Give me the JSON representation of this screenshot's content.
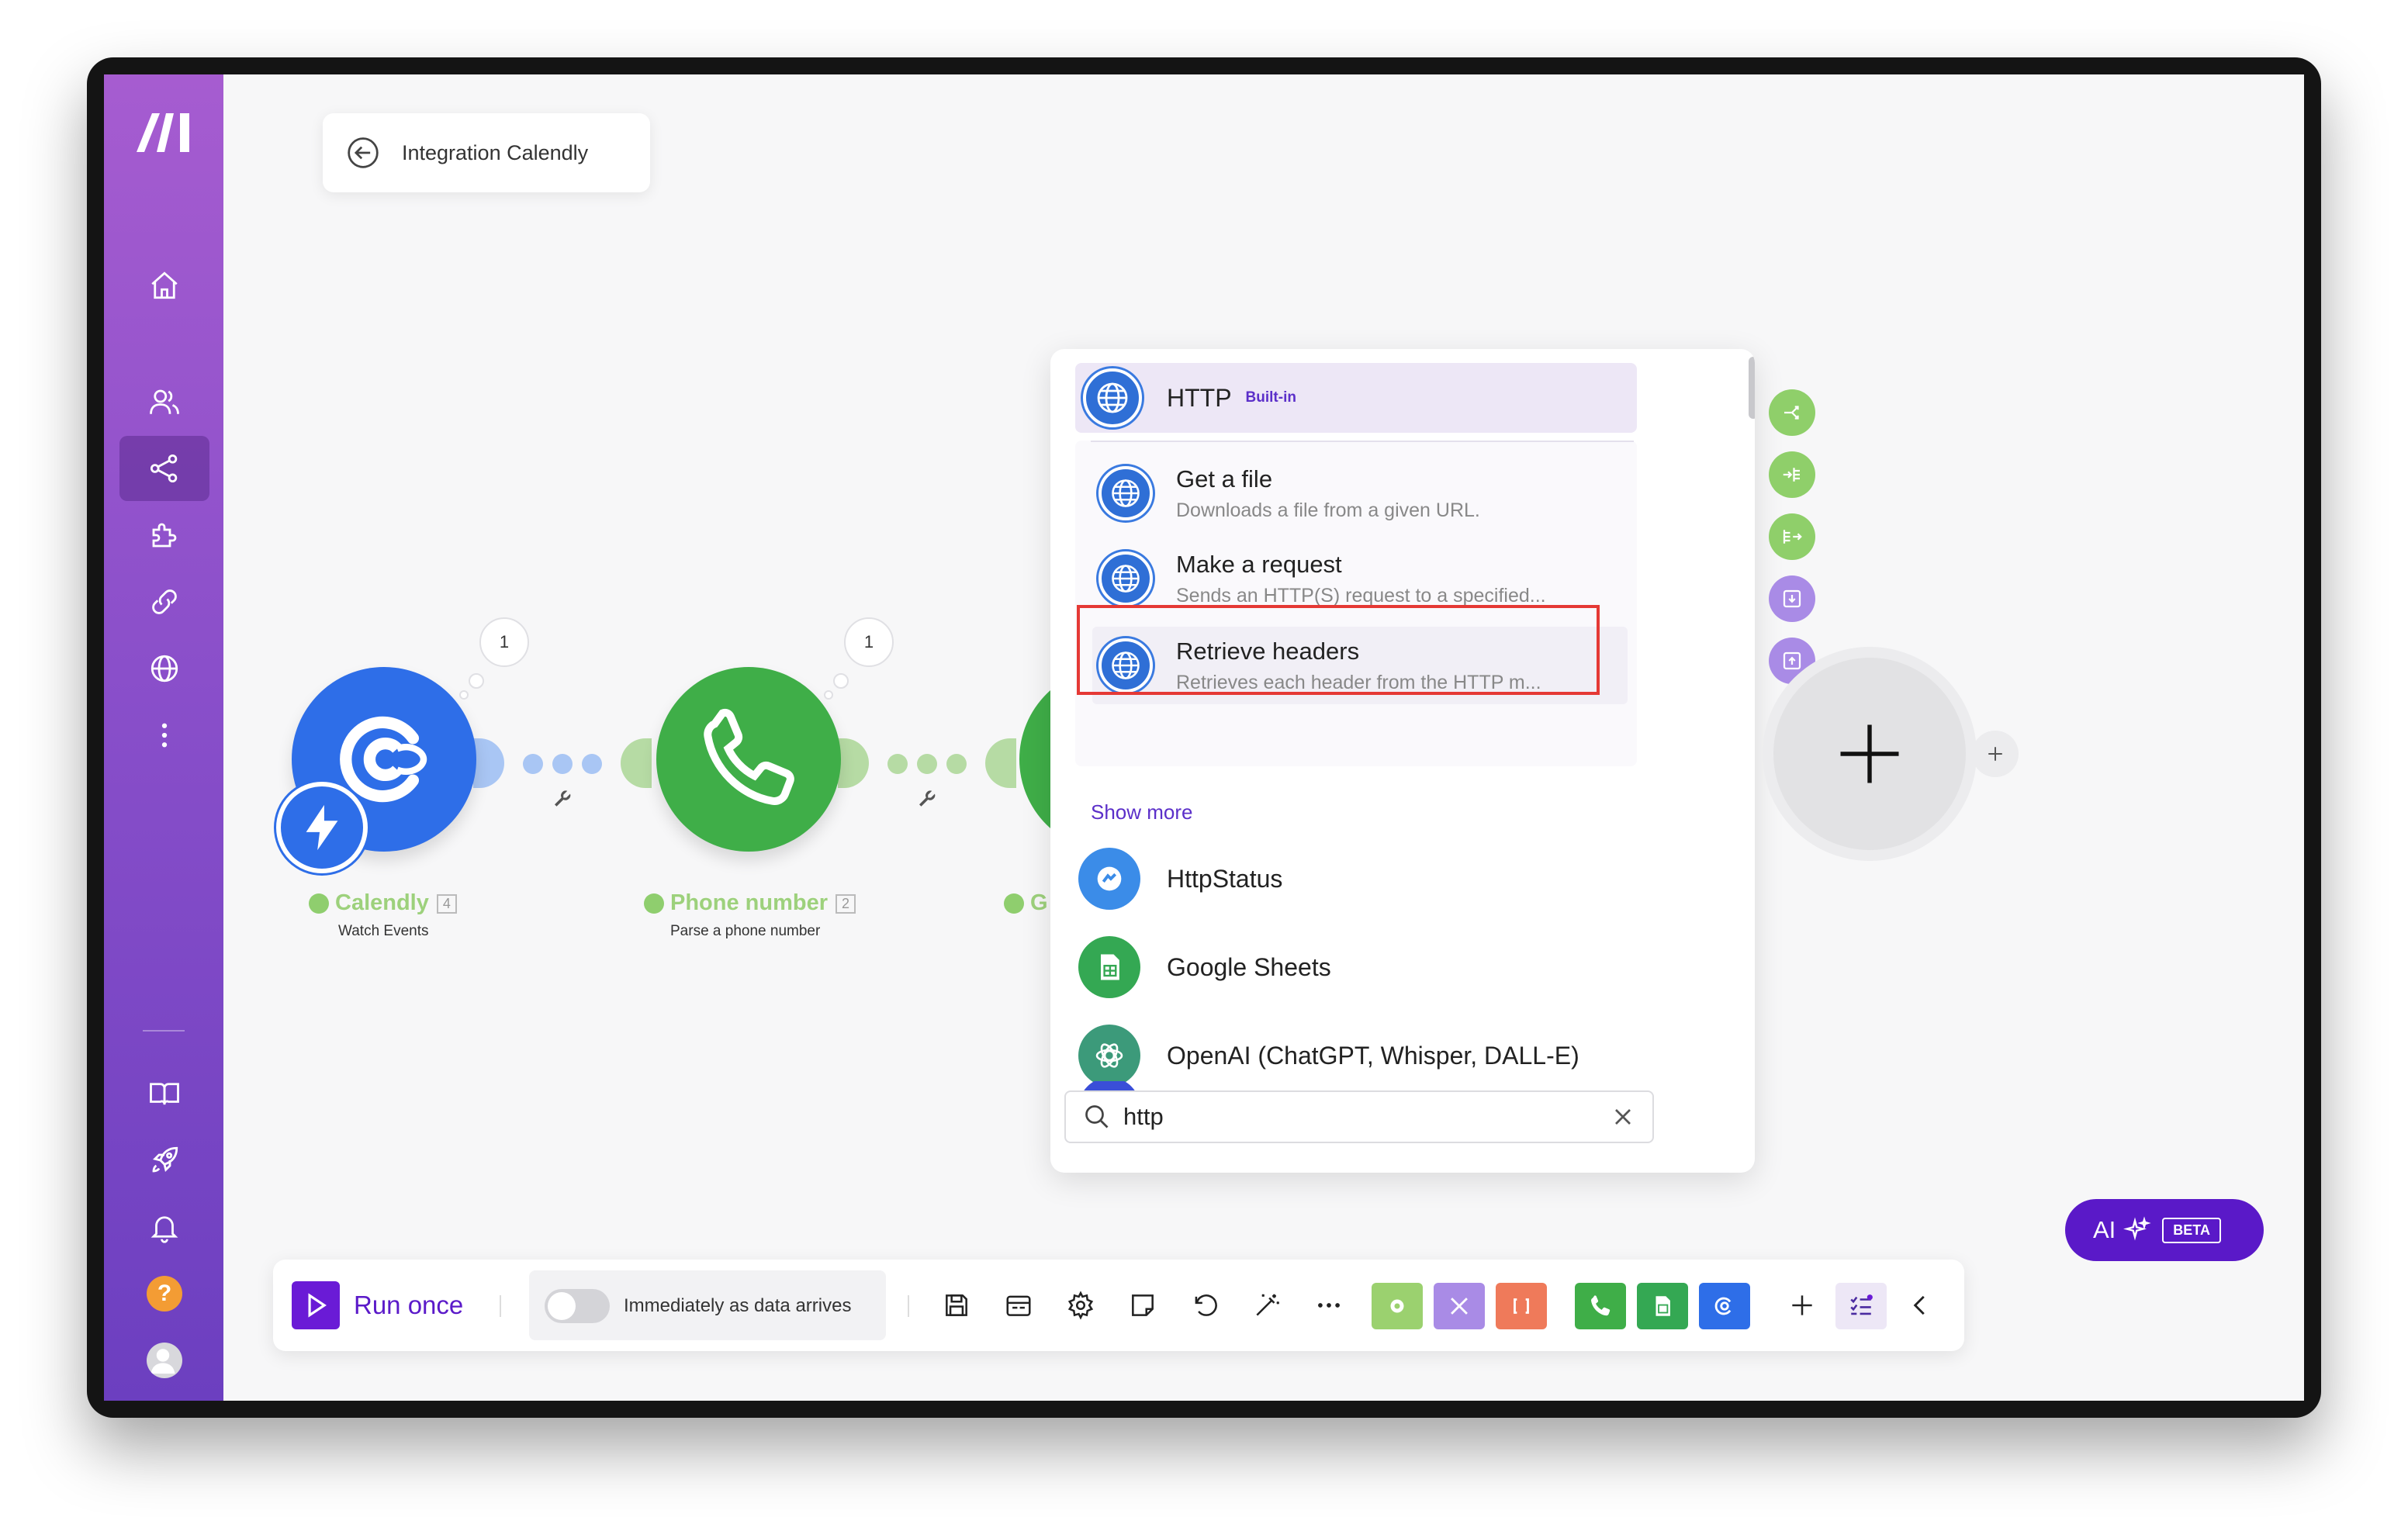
{
  "scenario": {
    "title": "Integration Calendly"
  },
  "modules": [
    {
      "name": "Calendly",
      "count": "4",
      "subtitle": "Watch Events",
      "bubble": "1",
      "color": "#2e6ee8"
    },
    {
      "name": "Phone number",
      "count": "2",
      "subtitle": "Parse a phone number",
      "bubble": "1",
      "color": "#3fae48"
    },
    {
      "name": "G",
      "color": "#3fae48"
    }
  ],
  "panel": {
    "header": {
      "title": "HTTP",
      "badge": "Built-in"
    },
    "actions": [
      {
        "title": "Get a file",
        "description": "Downloads a file from a given URL."
      },
      {
        "title": "Make a request",
        "description": "Sends an HTTP(S) request to a specified..."
      },
      {
        "title": "Retrieve headers",
        "description": "Retrieves each header from the HTTP m..."
      }
    ],
    "show_more": "Show more",
    "apps": [
      {
        "title": "HttpStatus"
      },
      {
        "title": "Google Sheets"
      },
      {
        "title": "OpenAI (ChatGPT, Whisper, DALL-E)"
      }
    ],
    "search": {
      "value": "http",
      "placeholder": ""
    }
  },
  "toolbar": {
    "run_label": "Run once",
    "schedule_label": "Immediately as data arrives"
  },
  "ai": {
    "label": "AI",
    "badge": "BETA"
  },
  "colors": {
    "accent": "#6a1bd6",
    "sidebar_top": "#a65cd0",
    "sidebar_bottom": "#6c3fc0",
    "highlight_border": "#e53935"
  }
}
